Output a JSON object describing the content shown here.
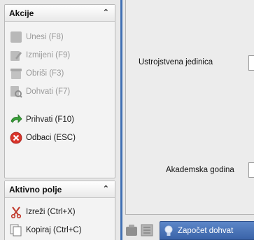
{
  "actions_panel": {
    "title": "Akcije",
    "collapse_icon": "double-chevron-up-icon",
    "items": [
      {
        "label": "Unesi (F8)",
        "icon": "add-record-icon",
        "enabled": false
      },
      {
        "label": "Izmijeni (F9)",
        "icon": "edit-icon",
        "enabled": false
      },
      {
        "label": "Obriši (F3)",
        "icon": "delete-icon",
        "enabled": false
      },
      {
        "label": "Dohvati (F7)",
        "icon": "fetch-icon",
        "enabled": false
      },
      {
        "label": "Prihvati (F10)",
        "icon": "accept-arrow-icon",
        "enabled": true
      },
      {
        "label": "Odbaci (ESC)",
        "icon": "cancel-icon",
        "enabled": true
      }
    ]
  },
  "field_panel": {
    "title": "Aktivno polje",
    "collapse_icon": "double-chevron-up-icon",
    "items": [
      {
        "label": "Izreži (Ctrl+X)",
        "icon": "scissors-icon"
      },
      {
        "label": "Kopiraj (Ctrl+C)",
        "icon": "copy-icon"
      }
    ]
  },
  "form": {
    "fields": [
      {
        "label": "Ustrojstvena jedinica",
        "value": ""
      },
      {
        "label": "Akademska godina",
        "value": ""
      }
    ]
  },
  "toolbar": {
    "start_fetch_label": "Započet dohvat"
  },
  "colors": {
    "accent": "#3f6fb3",
    "disabled_text": "#9a9a9a"
  }
}
